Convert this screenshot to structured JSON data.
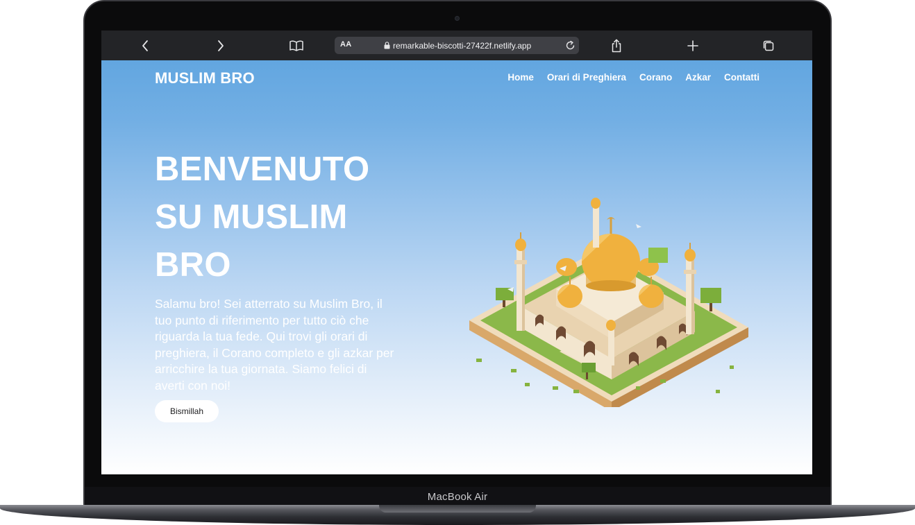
{
  "device": {
    "model_label": "MacBook Air"
  },
  "browser": {
    "text_size_label": "AA",
    "url": "remarkable-biscotti-27422f.netlify.app"
  },
  "site": {
    "logo": "MUSLIM BRO",
    "nav": [
      {
        "label": "Home"
      },
      {
        "label": "Orari di Preghiera"
      },
      {
        "label": "Corano"
      },
      {
        "label": "Azkar"
      },
      {
        "label": "Contatti"
      }
    ],
    "hero": {
      "title_line1": "BENVENUTO",
      "title_line2": "SU MUSLIM",
      "title_line3": "BRO",
      "text": "Salamu bro! Sei atterrato su Muslim Bro, il tuo punto di riferimento per tutto ciò che riguarda la tua fede. Qui trovi gli orari di preghiera, il Corano completo e gli azkar per arricchire la tua giornata. Siamo felici di averti con noi!",
      "cta_label": "Bismillah"
    }
  },
  "colors": {
    "sky_top": "#62a6e0",
    "sky_bottom": "#ffffff",
    "toolbar": "#232427",
    "dome_gold": "#f0b13e",
    "wall_cream": "#f3e6cf",
    "grass": "#8bb84a"
  },
  "icons": [
    "back-icon",
    "forward-icon",
    "bookmarks-icon",
    "lock-icon",
    "reload-icon",
    "share-icon",
    "new-tab-icon",
    "tabs-icon"
  ]
}
